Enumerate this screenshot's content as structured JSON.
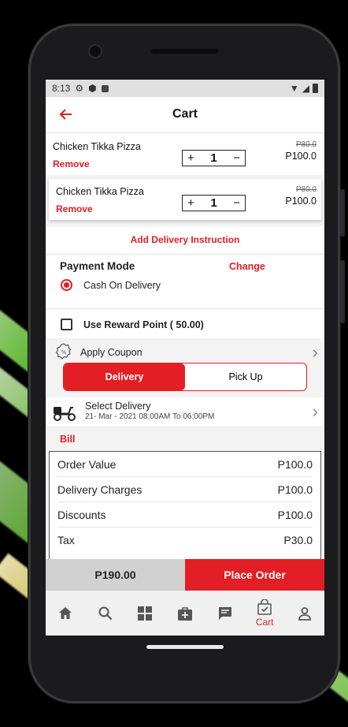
{
  "status_bar": {
    "time": "8:13"
  },
  "header": {
    "title": "Cart"
  },
  "cart_items": [
    {
      "name": "Chicken Tikka Pizza",
      "remove_label": "Remove",
      "quantity": "1",
      "original_price": "P80.0",
      "price": "P100.0"
    },
    {
      "name": "Chicken Tikka Pizza",
      "remove_label": "Remove",
      "quantity": "1",
      "original_price": "P80.0",
      "price": "P100.0"
    }
  ],
  "delivery_instruction_label": "Add Delivery Instruction",
  "payment": {
    "title": "Payment Mode",
    "change_label": "Change",
    "selected_option": "Cash On Delivery"
  },
  "reward": {
    "label": "Use Reward Point ( 50.00)"
  },
  "coupon": {
    "label": "Apply Coupon"
  },
  "fulfillment": {
    "delivery_label": "Delivery",
    "pickup_label": "Pick Up",
    "selected": "Delivery"
  },
  "delivery_slot": {
    "title": "Select Delivery",
    "time": "21- Mar - 2021 08:00AM To 06:00PM"
  },
  "bill": {
    "label": "Bill",
    "rows": [
      {
        "label": "Order Value",
        "value": "P100.0"
      },
      {
        "label": "Delivery Charges",
        "value": "P100.0"
      },
      {
        "label": "Discounts",
        "value": "P100.0"
      },
      {
        "label": "Tax",
        "value": "P30.0"
      }
    ]
  },
  "checkout": {
    "total": "P190.00",
    "place_order_label": "Place Order"
  },
  "bottom_nav": {
    "items": [
      "home-icon",
      "search-icon",
      "categories-icon",
      "bag-plus-icon",
      "messages-icon",
      "cart-icon",
      "profile-icon"
    ],
    "active_label": "Cart"
  },
  "colors": {
    "accent": "#e31e24"
  }
}
